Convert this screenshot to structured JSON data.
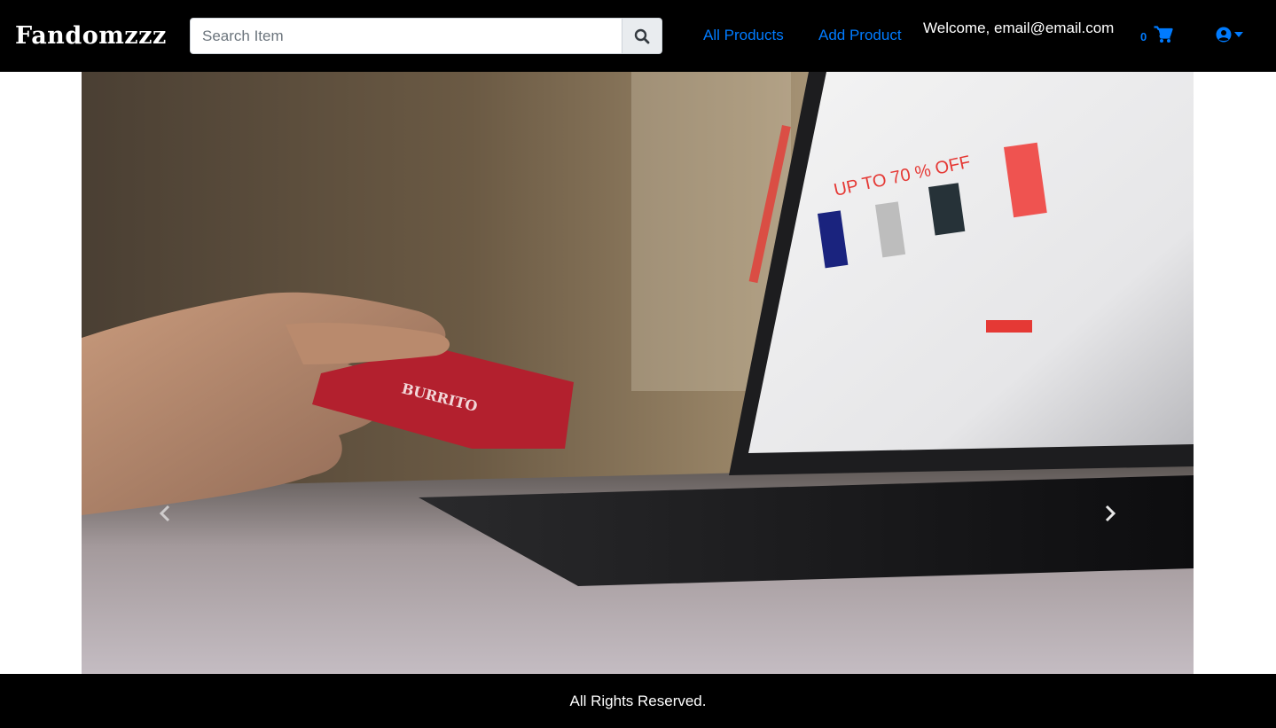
{
  "navbar": {
    "brand": "Fandomzzz",
    "search": {
      "placeholder": "Search Item",
      "value": ""
    },
    "links": {
      "all_products": "All Products",
      "add_product": "Add Product"
    },
    "welcome": "Welcome, email@email.com",
    "cart": {
      "count": "0",
      "icon": "shopping-cart-icon"
    },
    "user_icon": "user-circle-icon",
    "accent_color": "#007bff"
  },
  "carousel": {
    "slide_image": "hand holding red card in front of laptop showing online shop",
    "card_text": "BURRITO",
    "screen_banner": "UP TO 70 % OFF",
    "prev_icon": "chevron-left-icon",
    "next_icon": "chevron-right-icon"
  },
  "footer": {
    "text": "All Rights Reserved."
  }
}
